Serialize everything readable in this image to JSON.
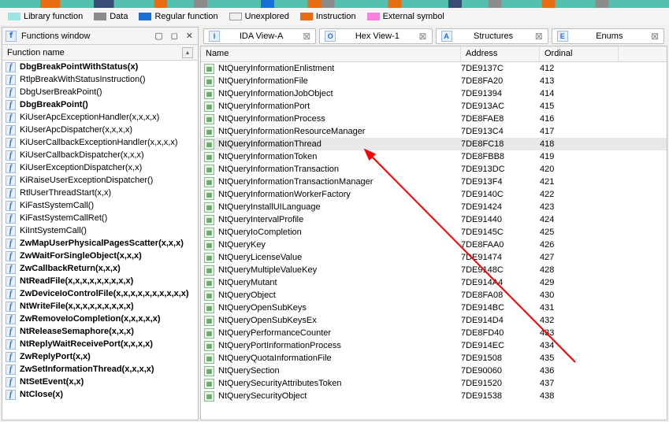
{
  "legend": {
    "library": "Library function",
    "data": "Data",
    "regular": "Regular function",
    "unexplored": "Unexplored",
    "instruction": "Instruction",
    "external": "External symbol"
  },
  "left": {
    "title": "Functions window",
    "column": "Function name",
    "items": [
      {
        "name": "DbgBreakPointWithStatus(x)",
        "bold": true
      },
      {
        "name": "RtlpBreakWithStatusInstruction()",
        "bold": false
      },
      {
        "name": "DbgUserBreakPoint()",
        "bold": false
      },
      {
        "name": "DbgBreakPoint()",
        "bold": true
      },
      {
        "name": "KiUserApcExceptionHandler(x,x,x,x)",
        "bold": false
      },
      {
        "name": "KiUserApcDispatcher(x,x,x,x)",
        "bold": false
      },
      {
        "name": "KiUserCallbackExceptionHandler(x,x,x,x)",
        "bold": false
      },
      {
        "name": "KiUserCallbackDispatcher(x,x,x)",
        "bold": false
      },
      {
        "name": "KiUserExceptionDispatcher(x,x)",
        "bold": false
      },
      {
        "name": "KiRaiseUserExceptionDispatcher()",
        "bold": false
      },
      {
        "name": "RtlUserThreadStart(x,x)",
        "bold": false
      },
      {
        "name": "KiFastSystemCall()",
        "bold": false
      },
      {
        "name": "KiFastSystemCallRet()",
        "bold": false
      },
      {
        "name": "KiIntSystemCall()",
        "bold": false
      },
      {
        "name": "ZwMapUserPhysicalPagesScatter(x,x,x)",
        "bold": true
      },
      {
        "name": "ZwWaitForSingleObject(x,x,x)",
        "bold": true
      },
      {
        "name": "ZwCallbackReturn(x,x,x)",
        "bold": true
      },
      {
        "name": "NtReadFile(x,x,x,x,x,x,x,x,x)",
        "bold": true
      },
      {
        "name": "ZwDeviceIoControlFile(x,x,x,x,x,x,x,x,x,x)",
        "bold": true
      },
      {
        "name": "NtWriteFile(x,x,x,x,x,x,x,x,x)",
        "bold": true
      },
      {
        "name": "ZwRemoveIoCompletion(x,x,x,x,x)",
        "bold": true
      },
      {
        "name": "NtReleaseSemaphore(x,x,x)",
        "bold": true
      },
      {
        "name": "NtReplyWaitReceivePort(x,x,x,x)",
        "bold": true
      },
      {
        "name": "ZwReplyPort(x,x)",
        "bold": true
      },
      {
        "name": "ZwSetInformationThread(x,x,x,x)",
        "bold": true
      },
      {
        "name": "NtSetEvent(x,x)",
        "bold": true
      },
      {
        "name": "NtClose(x)",
        "bold": true
      }
    ]
  },
  "tabs": [
    {
      "label": "IDA View-A",
      "icon": "I"
    },
    {
      "label": "Hex View-1",
      "icon": "O"
    },
    {
      "label": "Structures",
      "icon": "A"
    },
    {
      "label": "Enums",
      "icon": "E"
    }
  ],
  "exports": {
    "cols": {
      "name": "Name",
      "address": "Address",
      "ordinal": "Ordinal"
    },
    "highlighted_index": 7,
    "rows": [
      {
        "name": "NtQueryInformationEnlistment",
        "addr": "7DE9137C",
        "ord": "412"
      },
      {
        "name": "NtQueryInformationFile",
        "addr": "7DE8FA20",
        "ord": "413"
      },
      {
        "name": "NtQueryInformationJobObject",
        "addr": "7DE91394",
        "ord": "414"
      },
      {
        "name": "NtQueryInformationPort",
        "addr": "7DE913AC",
        "ord": "415"
      },
      {
        "name": "NtQueryInformationProcess",
        "addr": "7DE8FAE8",
        "ord": "416"
      },
      {
        "name": "NtQueryInformationResourceManager",
        "addr": "7DE913C4",
        "ord": "417"
      },
      {
        "name": "NtQueryInformationThread",
        "addr": "7DE8FC18",
        "ord": "418"
      },
      {
        "name": "NtQueryInformationToken",
        "addr": "7DE8FBB8",
        "ord": "419"
      },
      {
        "name": "NtQueryInformationTransaction",
        "addr": "7DE913DC",
        "ord": "420"
      },
      {
        "name": "NtQueryInformationTransactionManager",
        "addr": "7DE913F4",
        "ord": "421"
      },
      {
        "name": "NtQueryInformationWorkerFactory",
        "addr": "7DE9140C",
        "ord": "422"
      },
      {
        "name": "NtQueryInstallUILanguage",
        "addr": "7DE91424",
        "ord": "423"
      },
      {
        "name": "NtQueryIntervalProfile",
        "addr": "7DE91440",
        "ord": "424"
      },
      {
        "name": "NtQueryIoCompletion",
        "addr": "7DE9145C",
        "ord": "425"
      },
      {
        "name": "NtQueryKey",
        "addr": "7DE8FAA0",
        "ord": "426"
      },
      {
        "name": "NtQueryLicenseValue",
        "addr": "7DE91474",
        "ord": "427"
      },
      {
        "name": "NtQueryMultipleValueKey",
        "addr": "7DE9148C",
        "ord": "428"
      },
      {
        "name": "NtQueryMutant",
        "addr": "7DE914A4",
        "ord": "429"
      },
      {
        "name": "NtQueryObject",
        "addr": "7DE8FA08",
        "ord": "430"
      },
      {
        "name": "NtQueryOpenSubKeys",
        "addr": "7DE914BC",
        "ord": "431"
      },
      {
        "name": "NtQueryOpenSubKeysEx",
        "addr": "7DE914D4",
        "ord": "432"
      },
      {
        "name": "NtQueryPerformanceCounter",
        "addr": "7DE8FD40",
        "ord": "433"
      },
      {
        "name": "NtQueryPortInformationProcess",
        "addr": "7DE914EC",
        "ord": "434"
      },
      {
        "name": "NtQueryQuotaInformationFile",
        "addr": "7DE91508",
        "ord": "435"
      },
      {
        "name": "NtQuerySection",
        "addr": "7DE90060",
        "ord": "436"
      },
      {
        "name": "NtQuerySecurityAttributesToken",
        "addr": "7DE91520",
        "ord": "437"
      },
      {
        "name": "NtQuerySecurityObject",
        "addr": "7DE91538",
        "ord": "438"
      }
    ]
  }
}
